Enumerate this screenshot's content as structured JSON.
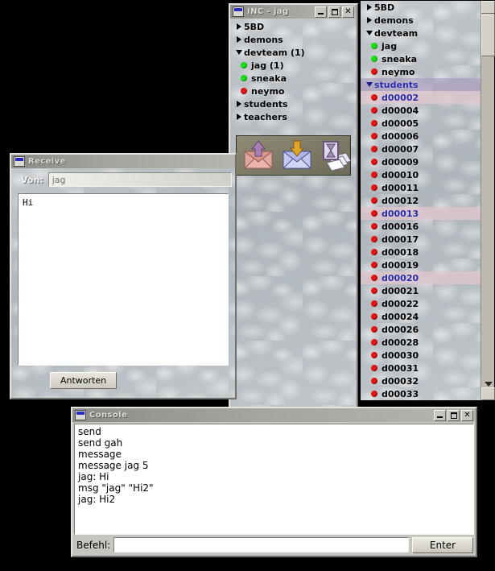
{
  "desktop": {
    "background": "#000000"
  },
  "user_list_window": {
    "name": "buddy-list",
    "scrollbar": {
      "up_icon": "scroll-up-icon",
      "down_icon": "scroll-down-icon"
    },
    "rows": [
      {
        "label": "5BD",
        "kind": "group",
        "expanded": false,
        "selected": false
      },
      {
        "label": "demons",
        "kind": "group",
        "expanded": false,
        "selected": false
      },
      {
        "label": "devteam",
        "kind": "group",
        "expanded": true,
        "selected": false
      },
      {
        "label": "jag",
        "kind": "user",
        "online": true,
        "selected": false
      },
      {
        "label": "sneaka",
        "kind": "user",
        "online": true,
        "selected": false
      },
      {
        "label": "neymo",
        "kind": "user",
        "online": false,
        "selected": false
      },
      {
        "label": "students",
        "kind": "group",
        "expanded": true,
        "selected": true
      },
      {
        "label": "d00002",
        "kind": "user",
        "online": false,
        "selected": true
      },
      {
        "label": "d00004",
        "kind": "user",
        "online": false,
        "selected": false
      },
      {
        "label": "d00005",
        "kind": "user",
        "online": false,
        "selected": false
      },
      {
        "label": "d00006",
        "kind": "user",
        "online": false,
        "selected": false
      },
      {
        "label": "d00007",
        "kind": "user",
        "online": false,
        "selected": false
      },
      {
        "label": "d00009",
        "kind": "user",
        "online": false,
        "selected": false
      },
      {
        "label": "d00010",
        "kind": "user",
        "online": false,
        "selected": false
      },
      {
        "label": "d00011",
        "kind": "user",
        "online": false,
        "selected": false
      },
      {
        "label": "d00012",
        "kind": "user",
        "online": false,
        "selected": false
      },
      {
        "label": "d00013",
        "kind": "user",
        "online": false,
        "selected": true
      },
      {
        "label": "d00016",
        "kind": "user",
        "online": false,
        "selected": false
      },
      {
        "label": "d00017",
        "kind": "user",
        "online": false,
        "selected": false
      },
      {
        "label": "d00018",
        "kind": "user",
        "online": false,
        "selected": false
      },
      {
        "label": "d00019",
        "kind": "user",
        "online": false,
        "selected": false
      },
      {
        "label": "d00020",
        "kind": "user",
        "online": false,
        "selected": true
      },
      {
        "label": "d00021",
        "kind": "user",
        "online": false,
        "selected": false
      },
      {
        "label": "d00022",
        "kind": "user",
        "online": false,
        "selected": false
      },
      {
        "label": "d00024",
        "kind": "user",
        "online": false,
        "selected": false
      },
      {
        "label": "d00026",
        "kind": "user",
        "online": false,
        "selected": false
      },
      {
        "label": "d00028",
        "kind": "user",
        "online": false,
        "selected": false
      },
      {
        "label": "d00030",
        "kind": "user",
        "online": false,
        "selected": false
      },
      {
        "label": "d00031",
        "kind": "user",
        "online": false,
        "selected": false
      },
      {
        "label": "d00032",
        "kind": "user",
        "online": false,
        "selected": false
      },
      {
        "label": "d00033",
        "kind": "user",
        "online": false,
        "selected": false
      }
    ]
  },
  "inc_window": {
    "title": "INC - jag",
    "buttons": {
      "minimize": "minimize-icon",
      "maximize": "maximize-icon",
      "close": "close-icon"
    },
    "rows": [
      {
        "label": "5BD",
        "kind": "group",
        "expanded": false
      },
      {
        "label": "demons",
        "kind": "group",
        "expanded": false
      },
      {
        "label": "devteam (1)",
        "kind": "group",
        "expanded": true
      },
      {
        "label": "jag (1)",
        "kind": "user",
        "online": true
      },
      {
        "label": "sneaka",
        "kind": "user",
        "online": true
      },
      {
        "label": "neymo",
        "kind": "user",
        "online": false
      },
      {
        "label": "students",
        "kind": "group",
        "expanded": false
      },
      {
        "label": "teachers",
        "kind": "group",
        "expanded": false
      }
    ],
    "toolbar": [
      {
        "name": "send-mail-icon",
        "tip": "outgoing envelope with up arrow"
      },
      {
        "name": "receive-mail-icon",
        "tip": "incoming envelope with down arrow"
      },
      {
        "name": "pending-mail-icon",
        "tip": "hourglass over documents"
      }
    ]
  },
  "receive_window": {
    "title": "Receive",
    "from_label": "Von:",
    "from_value": "jag",
    "message": "Hi",
    "reply_button": "Antworten"
  },
  "console_window": {
    "title": "Console",
    "buttons": {
      "minimize": "minimize-icon",
      "maximize": "maximize-icon",
      "close": "close-icon"
    },
    "log": [
      "send",
      "send gah",
      "message",
      "message jag 5",
      "jag: Hi",
      "msg \"jag\" \"Hi2\"",
      "jag: Hi2"
    ],
    "input_label": "Befehl:",
    "input_value": "",
    "enter_button": "Enter"
  },
  "colors": {
    "online": "#18df18",
    "offline": "#e21414",
    "selected_group": "#a896be",
    "selected_user": "#e2c6ce",
    "selected_text": "#2b2baa",
    "titlebar": "#a5a5a0"
  }
}
